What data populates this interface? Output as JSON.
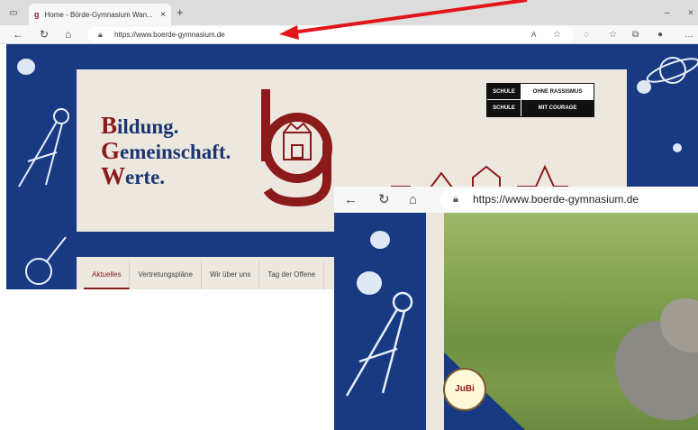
{
  "browser": {
    "tab_title": "Home - Börde-Gymnasium Wan...",
    "tab_close": "×",
    "new_tab": "+",
    "url": "https://www.boerde-gymnasium.de",
    "window_controls": {
      "minimize": "–",
      "close": "×"
    }
  },
  "site": {
    "brand": {
      "line1_cap": "B",
      "line1_rest": "ildung.",
      "line2_cap": "G",
      "line2_rest": "emeinschaft.",
      "line3_cap": "W",
      "line3_rest": "erte."
    },
    "badge": {
      "row1_left": "SCHULE",
      "row1_right": "OHNE RASSISMUS",
      "row2_left": "SCHULE",
      "row2_right": "MIT COURAGE"
    },
    "menu": [
      "Aktuelles",
      "Vertretungspläne",
      "Wir über uns",
      "Tag der Offene"
    ],
    "jubi_label": "JuBi"
  },
  "overlay_browser": {
    "url": "https://www.boerde-gymnasium.de"
  },
  "colors": {
    "site_navy": "#173a82",
    "brand_red": "#8b1a1a",
    "brand_blue": "#1b3570",
    "header_beige": "#ece8e0",
    "annotation_arrow": "#e3141a"
  }
}
